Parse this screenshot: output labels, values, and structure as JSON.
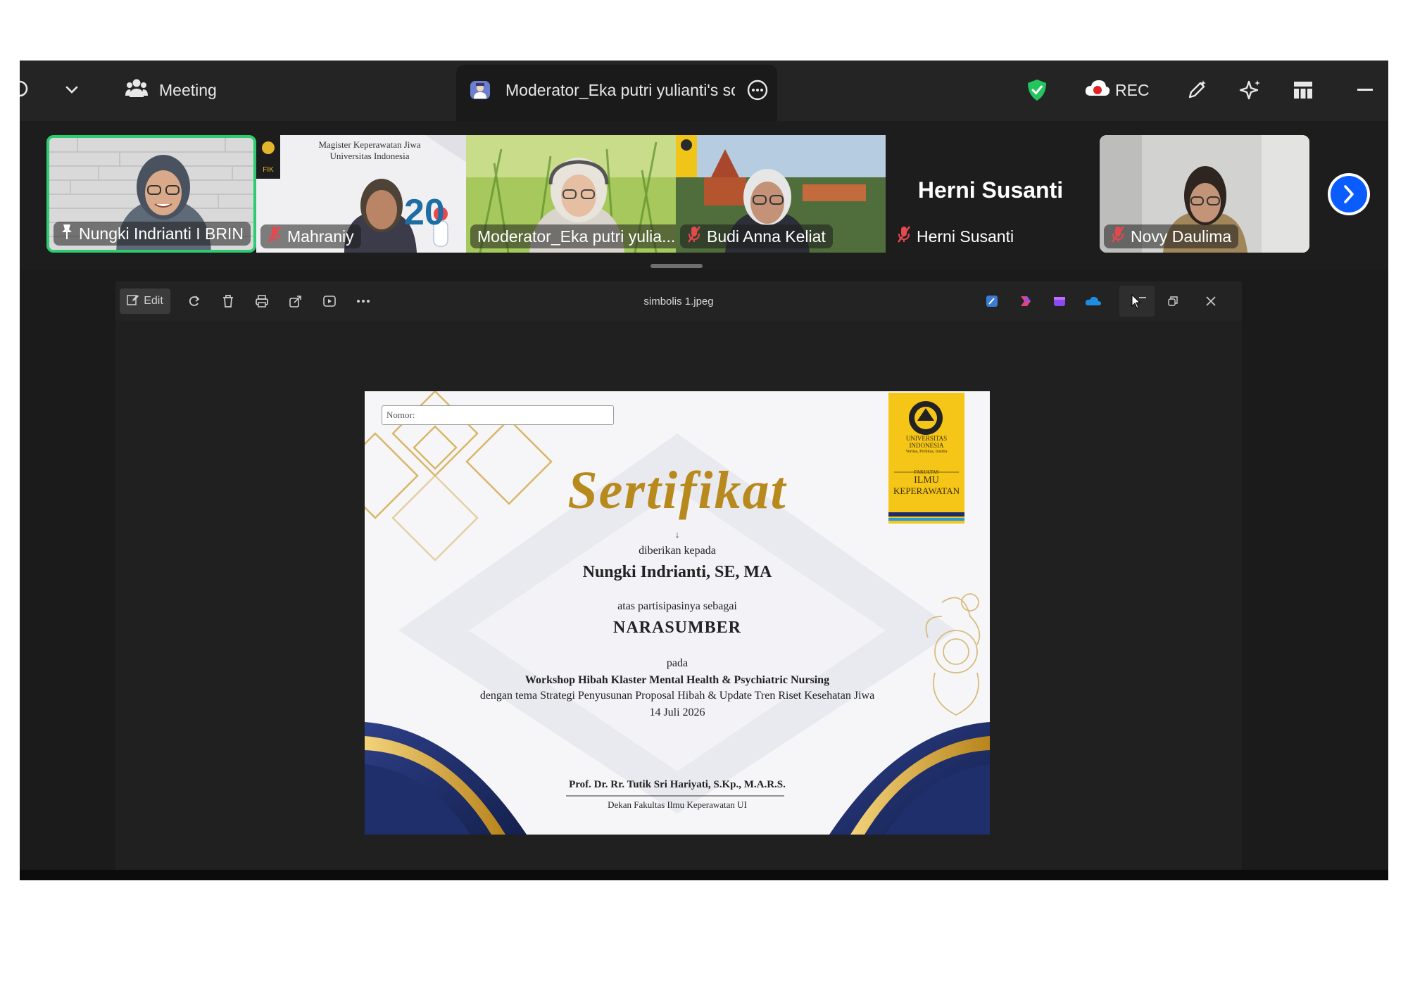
{
  "topbar": {
    "meeting_label": "Meeting",
    "share_tab_label": "Moderator_Eka putri yulianti's scr",
    "rec_label": "REC"
  },
  "participants": [
    {
      "name": "Nungki Indrianti I BRIN",
      "status": "pinned"
    },
    {
      "name": "Mahraniy",
      "status": "muted"
    },
    {
      "name": "Moderator_Eka putri yulia...",
      "status": "unmuted"
    },
    {
      "name": "Budi Anna Keliat",
      "status": "muted"
    },
    {
      "name": "Herni Susanti",
      "status": "muted",
      "display_name": "Herni Susanti"
    },
    {
      "name": "Novy Daulima",
      "status": "muted"
    }
  ],
  "banner": {
    "line1": "Magister Keperawatan Jiwa",
    "line2": "Universitas Indonesia",
    "badge": "FIK",
    "number": "20"
  },
  "viewer": {
    "edit_label": "Edit",
    "file_name": "simbolis 1.jpeg"
  },
  "certificate": {
    "nomor_label": "Nomor:",
    "title": "Sertifikat",
    "arrow_mark": "↓",
    "given_to": "diberikan kepada",
    "recipient": "Nungki Indrianti, SE, MA",
    "for_participation": "atas partisipasinya sebagai",
    "role": "NARASUMBER",
    "at": "pada",
    "event": "Workshop Hibah Klaster Mental Health & Psychiatric Nursing",
    "theme": "dengan tema Strategi Penyusunan Proposal Hibah & Update Tren Riset Kesehatan Jiwa",
    "date": "14 Juli 2026",
    "signer": "Prof. Dr. Rr. Tutik Sri Hariyati, S.Kp., M.A.R.S.",
    "signer_title": "Dekan Fakultas Ilmu Keperawatan UI",
    "logo_univ": "UNIVERSITAS INDONESIA",
    "logo_tag": "Veritas, Probitas, Iustitia",
    "logo_faculty_small": "FAKULTAS",
    "logo_faculty_line1": "ILMU",
    "logo_faculty_line2": "KEPERAWATAN"
  },
  "colors": {
    "active_speaker_border": "#2ecc71",
    "shield": "#22c55e",
    "next_button": "#0b5cff",
    "gold": "#b88a1e",
    "navy": "#1f2f6b"
  }
}
